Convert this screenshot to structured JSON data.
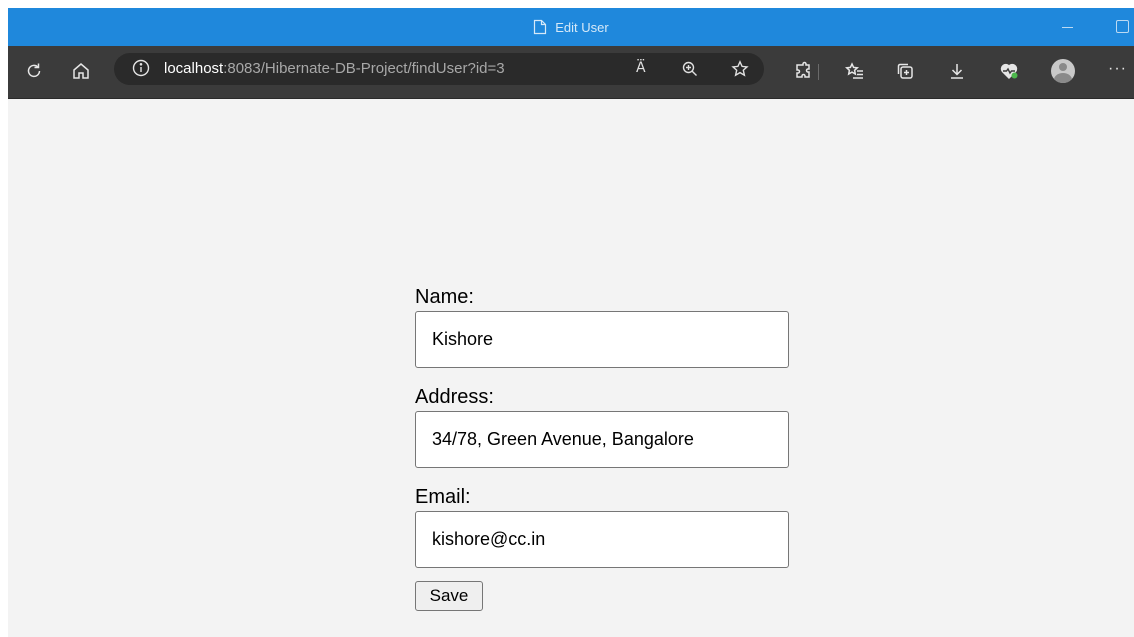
{
  "window": {
    "title": "Edit User",
    "accent": "#1f88dc"
  },
  "toolbar": {
    "url_host": "localhost",
    "url_rest": ":8083/Hibernate-DB-Project/findUser?id=3",
    "read_aloud_label": "A⃛",
    "more_label": "···"
  },
  "icons": [
    "refresh-icon",
    "home-icon",
    "info-icon",
    "read-aloud-icon",
    "zoom-icon",
    "favorite-star-icon",
    "extensions-icon",
    "favorites-list-icon",
    "collections-icon",
    "download-icon",
    "health-icon",
    "profile-avatar",
    "more-icon"
  ],
  "form": {
    "name_label": "Name:",
    "name_value": "Kishore",
    "address_label": "Address:",
    "address_value": "34/78, Green Avenue, Bangalore",
    "email_label": "Email:",
    "email_value": "kishore@cc.in",
    "save_label": "Save"
  }
}
